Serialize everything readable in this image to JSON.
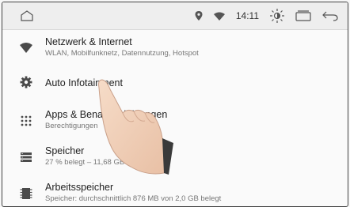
{
  "statusbar": {
    "time": "14:11",
    "icons": [
      "home-outline-icon",
      "location-icon",
      "wifi-icon",
      "brightness-icon",
      "recent-apps-icon",
      "back-icon"
    ]
  },
  "settings": {
    "items": [
      {
        "title": "Netzwerk & Internet",
        "subtitle": "WLAN, Mobilfunknetz, Datennutzung, Hotspot",
        "icon": "wifi-icon"
      },
      {
        "title": "Auto Infotainment",
        "subtitle": "",
        "icon": "gear-icon"
      },
      {
        "title": "Apps & Benachrichtigungen",
        "subtitle": "Berechtigungen",
        "icon": "apps-grid-icon"
      },
      {
        "title": "Speicher",
        "subtitle": "27 % belegt – 11,68 GB frei",
        "icon": "storage-icon"
      },
      {
        "title": "Arbeitsspeicher",
        "subtitle": "Speicher: durchschnittlich 876 MB von 2,0 GB belegt",
        "icon": "memory-icon"
      }
    ]
  },
  "colors": {
    "icon": "#4a4a4a",
    "background": "#fafafa",
    "statusbar": "#eeeeee"
  }
}
